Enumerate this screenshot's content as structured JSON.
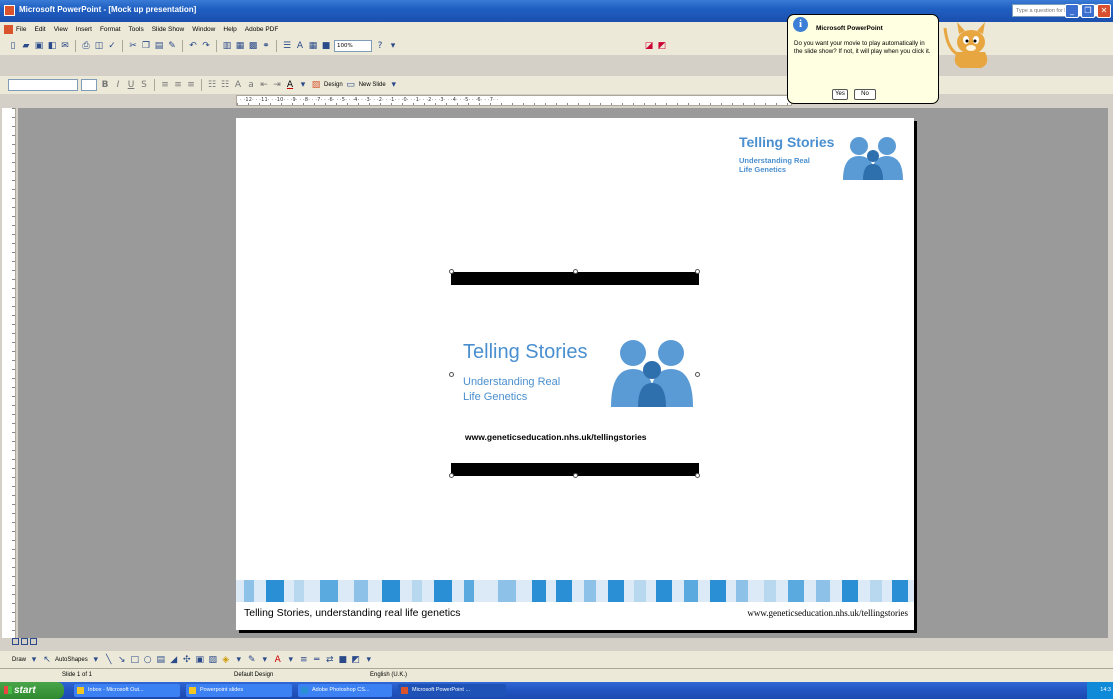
{
  "window": {
    "title": "Microsoft PowerPoint - [Mock up presentation]",
    "help_placeholder": "Type a question for help"
  },
  "menu": [
    "File",
    "Edit",
    "View",
    "Insert",
    "Format",
    "Tools",
    "Slide Show",
    "Window",
    "Help",
    "Adobe PDF"
  ],
  "toolbar": {
    "zoom": "100%",
    "design_label": "Design",
    "new_slide_label": "New Slide"
  },
  "ruler": {
    "h_labels": "· ·12· · ·11· · ·10· · ·9· · ·8· · ·7· · ·6· · ·5· · ·4· · ·3· · ·2· · ·1· · ·0· · ·1· · ·2· · ·3· · ·4· · ·5· · ·6· · ·7· ·"
  },
  "slide": {
    "logo_title": "Telling Stories",
    "logo_subtitle_1": "Understanding Real",
    "logo_subtitle_2": "Life Genetics",
    "movie_title": "Telling Stories",
    "movie_subtitle_1": "Understanding Real",
    "movie_subtitle_2": "Life Genetics",
    "movie_url": "www.geneticseducation.nhs.uk/tellingstories",
    "footer_left": "Telling Stories, understanding real life genetics",
    "footer_right": "www.geneticseducation.nhs.uk/tellingstories",
    "brand_color": "#4a8fcf"
  },
  "balloon": {
    "title": "Microsoft PowerPoint",
    "message": "Do you want your movie to play automatically in the slide show? If not, it will play when you click it.",
    "yes_label": "Yes",
    "no_label": "No"
  },
  "drawbar": {
    "draw_label": "Draw",
    "autoshapes_label": "AutoShapes"
  },
  "status": {
    "slide": "Slide 1 of 1",
    "design": "Default Design",
    "language": "English (U.K.)"
  },
  "taskbar": {
    "start_label": "start",
    "tasks": [
      "Inbox - Microsoft Out...",
      "Powerpoint slides",
      "Adobe Photoshop CS...",
      "Microsoft PowerPoint ..."
    ],
    "clock": "14:3"
  }
}
